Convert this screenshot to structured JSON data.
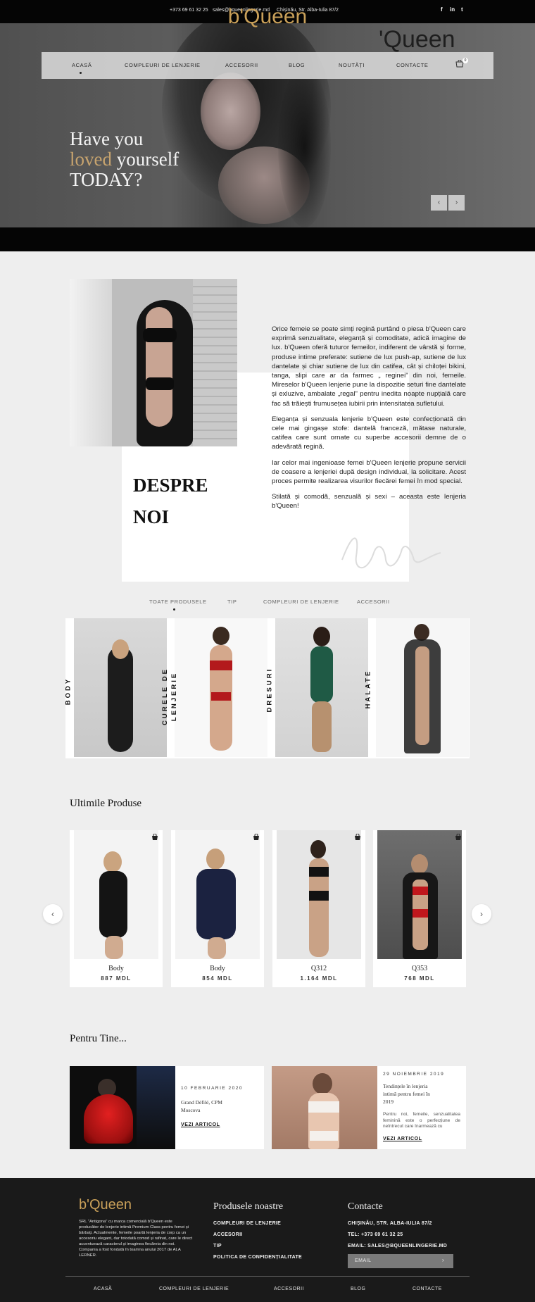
{
  "topbar": {
    "phone": "+373 69 61 32 25",
    "email": "sales@bqueenlingerie.md",
    "address": "Chișinău, Str. Alba-Iulia 87/2",
    "social": [
      "f",
      "in",
      "t"
    ]
  },
  "hero": {
    "logo": "b'Queen",
    "ghost_logo": "'Queen",
    "headline_line1": "Have you",
    "headline_gold": "loved",
    "headline_line2_rest": " yourself",
    "headline_line3": "TODAY?",
    "prev_label": "‹",
    "next_label": "›"
  },
  "nav": {
    "items": [
      "ACASĂ",
      "COMPLEURI DE LENJERIE",
      "ACCESORII",
      "BLOG",
      "NOUTĂȚI",
      "CONTACTE"
    ],
    "cart_count": "0"
  },
  "about": {
    "title_line1": "DESPRE",
    "title_line2": "NOI",
    "paragraphs": [
      "Orice femeie se poate simți regină purtând o piesa b'Queen care exprimă senzualitate, eleganță și comoditate, adică imagine de lux. b'Queen oferă tuturor femeilor, indiferent de vârstă și forme, produse intime preferate: sutiene de lux push-ap, sutiene de lux dantelate și chiar sutiene de lux din catifea, cât și chiloței bikini, tanga, slipi care ar da farmec „ reginei\" din noi, femeile. Mireselor b'Queen lenjerie pune la dispozitie seturi fine dantelate și exluzive, ambalate „regal\" pentru inedita noapte nupțială care fac să trăiești frumusețea iubirii prin intensitatea sufletului.",
      "Eleganța și senzuala lenjerie b'Queen este confecționată din cele mai gingașe stofe: dantelă franceză, mătase naturale, catifea care sunt ornate cu superbe accesorii demne de o adevărată regină.",
      "Iar celor mai ingenioase femei b'Queen lenjerie propune servicii de coasere a lenjeriei după design individual, la solicitare. Acest proces permite realizarea visurilor fiecărei femei în mod special.",
      "Stilată și comodă, senzuală și sexi – aceasta este lenjeria b'Queen!"
    ]
  },
  "tabs": [
    "TOATE PRODUSELE",
    "TIP",
    "COMPLEURI DE LENJERIE",
    "ACCESORII"
  ],
  "categories": [
    {
      "label": "BODY"
    },
    {
      "label": "CURELE DE LENJERIE"
    },
    {
      "label": "DRESURI"
    },
    {
      "label": "HALATE"
    }
  ],
  "latest": {
    "title": "Ultimile Produse",
    "prev": "‹",
    "next": "›",
    "products": [
      {
        "name": "Body",
        "price": "887 MDL"
      },
      {
        "name": "Body",
        "price": "854 MDL"
      },
      {
        "name": "Q312",
        "price": "1.164 MDL"
      },
      {
        "name": "Q353",
        "price": "768 MDL"
      }
    ]
  },
  "for_you": {
    "title": "Pentru Tine...",
    "posts": [
      {
        "date": "10 FEBRUARIE 2020",
        "title_line1": "Grand Défilé, CPM",
        "title_line2": "Moscova",
        "more": "VEZI ARTICOL"
      },
      {
        "date": "29 NOIEMBRIE 2019",
        "title": "Tendințele în lenjeria intimă pentru femei în 2019",
        "excerpt": "Pentru noi, femeile, senzualitatea feminină este o perfecțiune de neîntrecut care înarmează cu",
        "more": "VEZI ARTICOL"
      }
    ]
  },
  "footer": {
    "logo": "b'Queen",
    "description": "SRL \"Antigona\" cu marca comercială b'Queen este producător de lenjerie intimă Premium Class pentru femei și bărbați. Actualmente, femeile poartă lenjeria de corp ca un accesoriu elegant, dar totodată comod și rafinat, care le direct accentuează caracterul și imaginea fiecăreia din noi. Compania a fost fondată în toamna anului 2017 de ALA LERNER.",
    "products_title": "Produsele noastre",
    "product_links": [
      "COMPLEURI DE LENJERIE",
      "ACCESORII",
      "TIP",
      "POLITICA DE CONFIDENȚIALITATE"
    ],
    "contacts_title": "Contacte",
    "contact_address": "CHIȘINĂU, STR. ALBA-IULIA 87/2",
    "contact_phone": "TEL: +373 69 61 32 25",
    "contact_email": "EMAIL: SALES@BQUEENLINGERIE.MD",
    "email_placeholder": "EMAIL",
    "email_submit": "›",
    "nav": [
      "ACASĂ",
      "COMPLEURI DE LENJERIE",
      "ACCESORII",
      "BLOG",
      "CONTACTE"
    ]
  },
  "colors": {
    "gold": "#c9a059",
    "topbar_bg": "#050505",
    "footer_bg": "#1a1a1a",
    "page_bg": "#eeeeee"
  }
}
